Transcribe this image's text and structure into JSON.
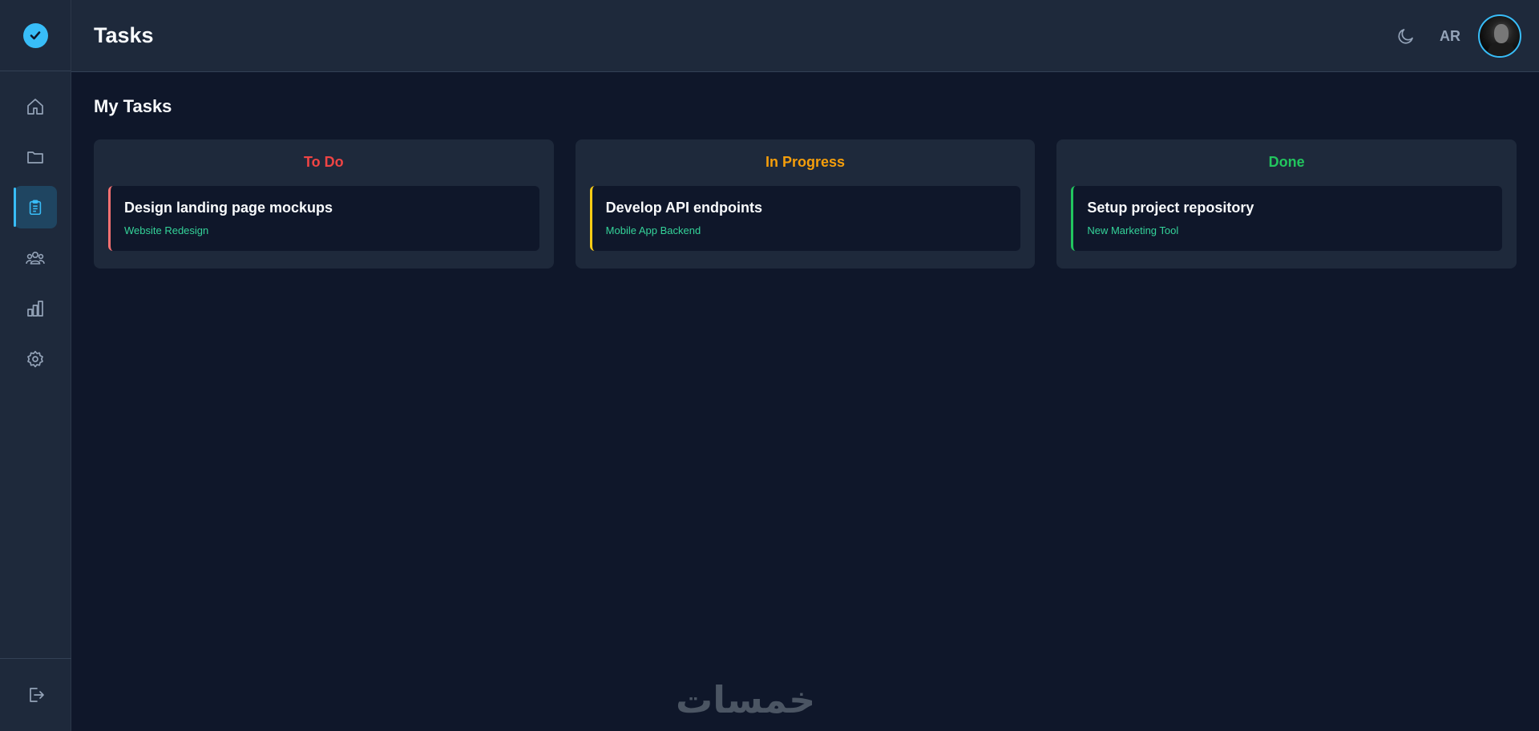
{
  "header": {
    "title": "Tasks",
    "language": "AR"
  },
  "main": {
    "section_title": "My Tasks",
    "columns": [
      {
        "title": "To Do",
        "color": "#ef4444",
        "cards": [
          {
            "title": "Design landing page mockups",
            "project": "Website Redesign",
            "accent": "#f87171"
          }
        ]
      },
      {
        "title": "In Progress",
        "color": "#f59e0b",
        "cards": [
          {
            "title": "Develop API endpoints",
            "project": "Mobile App Backend",
            "accent": "#facc15"
          }
        ]
      },
      {
        "title": "Done",
        "color": "#22c55e",
        "cards": [
          {
            "title": "Setup project repository",
            "project": "New Marketing Tool",
            "accent": "#22c55e"
          }
        ]
      }
    ]
  },
  "sidebar": {
    "items": [
      {
        "icon": "home-icon"
      },
      {
        "icon": "folder-icon"
      },
      {
        "icon": "clipboard-icon",
        "active": true
      },
      {
        "icon": "users-icon"
      },
      {
        "icon": "chart-icon"
      },
      {
        "icon": "gear-icon"
      }
    ],
    "bottom_icon": "logout-icon"
  },
  "watermark": "خمسات",
  "colors": {
    "accent": "#38bdf8",
    "background": "#0f172a",
    "panel": "#1e293b"
  }
}
